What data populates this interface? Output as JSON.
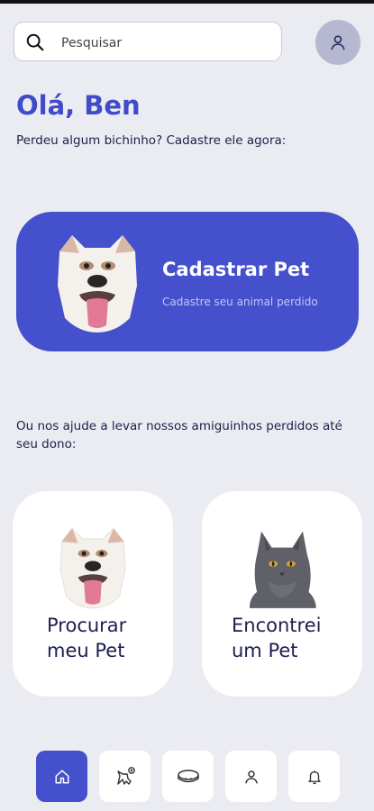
{
  "search": {
    "placeholder": "Pesquisar"
  },
  "greeting": "Olá, Ben",
  "subtitle": "Perdeu algum bichinho? Cadastre ele agora:",
  "register_card": {
    "title": "Cadastrar Pet",
    "subtitle": "Cadastre seu animal perdido"
  },
  "help_text": "Ou nos ajude a levar nossos amiguinhos perdidos até seu dono:",
  "cards": [
    {
      "label": "Procurar meu Pet",
      "icon": "bulldog-image"
    },
    {
      "label": "Encontrei um Pet",
      "icon": "cat-image"
    }
  ],
  "colors": {
    "accent": "#4450cc",
    "background": "#ebebf2",
    "text_dark": "#1e1f4d"
  },
  "nav_items": [
    "home-icon",
    "lost-pet-icon",
    "collar-icon",
    "profile-icon",
    "bell-icon"
  ]
}
